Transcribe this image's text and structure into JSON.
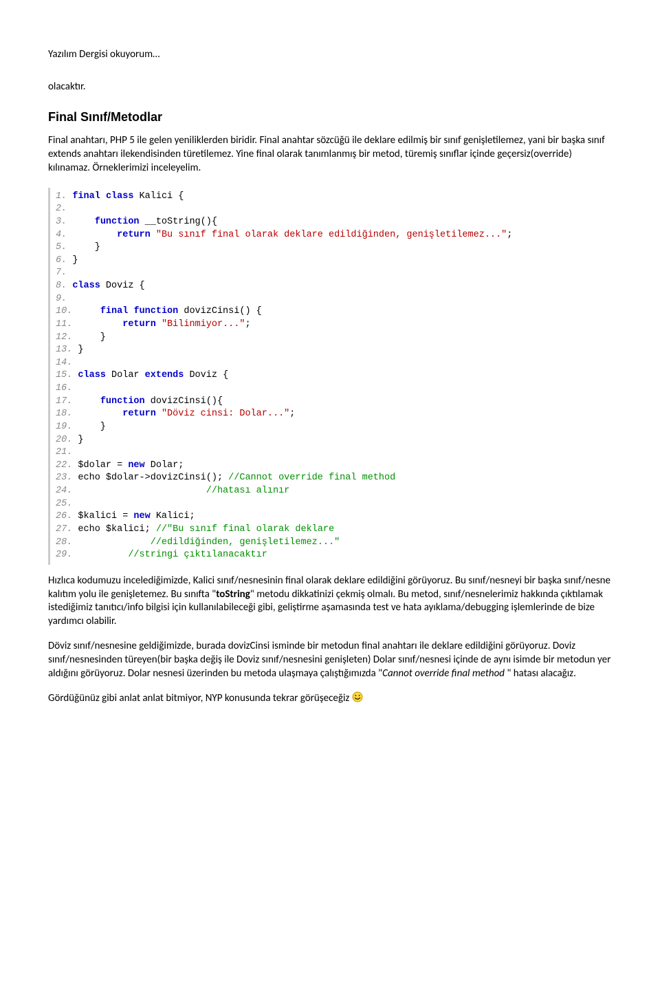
{
  "header": "Yazılım Dergisi okuyorum…",
  "lead": "olacaktır.",
  "section_title": "Final Sınıf/Metodlar",
  "intro": "Final anahtarı, PHP 5 ile gelen yeniliklerden biridir. Final anahtar sözcüğü ile deklare edilmiş bir sınıf genişletilemez, yani bir başka sınıf extends anahtarı ilekendisinden türetilemez. Yine final olarak tanımlanmış bir metod, türemiş sınıflar içinde geçersiz(override) kılınamaz. Örneklerimizi inceleyelim.",
  "code": [
    {
      "n": "1.",
      "t": [
        {
          "kw": "final"
        },
        {
          "p": " "
        },
        {
          "kw": "class"
        },
        {
          "p": " Kalici {"
        }
      ]
    },
    {
      "n": "2.",
      "t": []
    },
    {
      "n": "3.",
      "t": [
        {
          "p": "    "
        },
        {
          "kw": "function"
        },
        {
          "p": " __toString(){"
        }
      ]
    },
    {
      "n": "4.",
      "t": [
        {
          "p": "        "
        },
        {
          "kw": "return"
        },
        {
          "p": " "
        },
        {
          "str": "\"Bu sınıf final olarak deklare edildiğinden, genişletilemez...\""
        },
        {
          "p": ";"
        }
      ]
    },
    {
      "n": "5.",
      "t": [
        {
          "p": "    }"
        }
      ]
    },
    {
      "n": "6.",
      "t": [
        {
          "p": "}"
        }
      ]
    },
    {
      "n": "7.",
      "t": []
    },
    {
      "n": "8.",
      "t": [
        {
          "kw": "class"
        },
        {
          "p": " Doviz {"
        }
      ]
    },
    {
      "n": "9.",
      "t": []
    },
    {
      "n": "10.",
      "t": [
        {
          "p": "    "
        },
        {
          "kw": "final"
        },
        {
          "p": " "
        },
        {
          "kw": "function"
        },
        {
          "p": " dovizCinsi() {"
        }
      ]
    },
    {
      "n": "11.",
      "t": [
        {
          "p": "        "
        },
        {
          "kw": "return"
        },
        {
          "p": " "
        },
        {
          "str": "\"Bilinmiyor...\""
        },
        {
          "p": ";"
        }
      ]
    },
    {
      "n": "12.",
      "t": [
        {
          "p": "    }"
        }
      ]
    },
    {
      "n": "13.",
      "t": [
        {
          "p": "}"
        }
      ]
    },
    {
      "n": "14.",
      "t": []
    },
    {
      "n": "15.",
      "t": [
        {
          "kw": "class"
        },
        {
          "p": " Dolar "
        },
        {
          "kw": "extends"
        },
        {
          "p": " Doviz {"
        }
      ]
    },
    {
      "n": "16.",
      "t": []
    },
    {
      "n": "17.",
      "t": [
        {
          "p": "    "
        },
        {
          "kw": "function"
        },
        {
          "p": " dovizCinsi(){"
        }
      ]
    },
    {
      "n": "18.",
      "t": [
        {
          "p": "        "
        },
        {
          "kw": "return"
        },
        {
          "p": " "
        },
        {
          "str": "\"Döviz cinsi: Dolar...\""
        },
        {
          "p": ";"
        }
      ]
    },
    {
      "n": "19.",
      "t": [
        {
          "p": "    }"
        }
      ]
    },
    {
      "n": "20.",
      "t": [
        {
          "p": "}"
        }
      ]
    },
    {
      "n": "21.",
      "t": []
    },
    {
      "n": "22.",
      "t": [
        {
          "p": "$dolar = "
        },
        {
          "kw": "new"
        },
        {
          "p": " Dolar;"
        }
      ]
    },
    {
      "n": "23.",
      "t": [
        {
          "p": "echo $dolar->dovizCinsi(); "
        },
        {
          "cmt": "//Cannot override final method"
        }
      ]
    },
    {
      "n": "24.",
      "t": [
        {
          "p": "                       "
        },
        {
          "cmt": "//hatası alınır"
        }
      ]
    },
    {
      "n": "25.",
      "t": []
    },
    {
      "n": "26.",
      "t": [
        {
          "p": "$kalici = "
        },
        {
          "kw": "new"
        },
        {
          "p": " Kalici;"
        }
      ]
    },
    {
      "n": "27.",
      "t": [
        {
          "p": "echo $kalici; "
        },
        {
          "cmt": "//\"Bu sınıf final olarak deklare"
        }
      ]
    },
    {
      "n": "28.",
      "t": [
        {
          "p": "             "
        },
        {
          "cmt": "//edildiğinden, genişletilemez...\""
        }
      ]
    },
    {
      "n": "29.",
      "t": [
        {
          "p": "         "
        },
        {
          "cmt": "//stringi çıktılanacaktır"
        }
      ]
    }
  ],
  "para1": {
    "pre": "Hızlıca kodumuzu incelediğimizde, Kalici sınıf/nesnesinin final olarak deklare edildiğini görüyoruz. Bu sınıf/nesneyi bir başka sınıf/nesne kalıtım yolu ile genişletemez. Bu sınıfta \"",
    "bold": "toString",
    "post": "\" metodu dikkatinizi çekmiş olmalı. Bu metod, sınıf/nesnelerimiz hakkında çıktılamak istediğimiz tanıtıcı/info bilgisi için kullanılabileceği gibi, geliştirme aşamasında test ve hata ayıklama/debugging işlemlerinde de bize yardımcı olabilir."
  },
  "para2": {
    "pre": "Döviz sınıf/nesnesine geldiğimizde, burada dovizCinsi isminde bir metodun final anahtarı ile deklare edildiğini görüyoruz. Doviz sınıf/nesnesinden türeyen(bir başka değiş ile Doviz sınıf/nesnesini genişleten) Dolar sınıf/nesnesi içinde de aynı isimde bir metodun yer aldığını görüyoruz. Dolar nesnesi üzerinden bu metoda ulaşmaya çalıştığımızda \"",
    "ital": "Cannot override final method",
    "post": " \" hatası alacağız."
  },
  "closing": "Gördüğünüz gibi anlat anlat bitmiyor, NYP konusunda tekrar görüşeceğiz "
}
